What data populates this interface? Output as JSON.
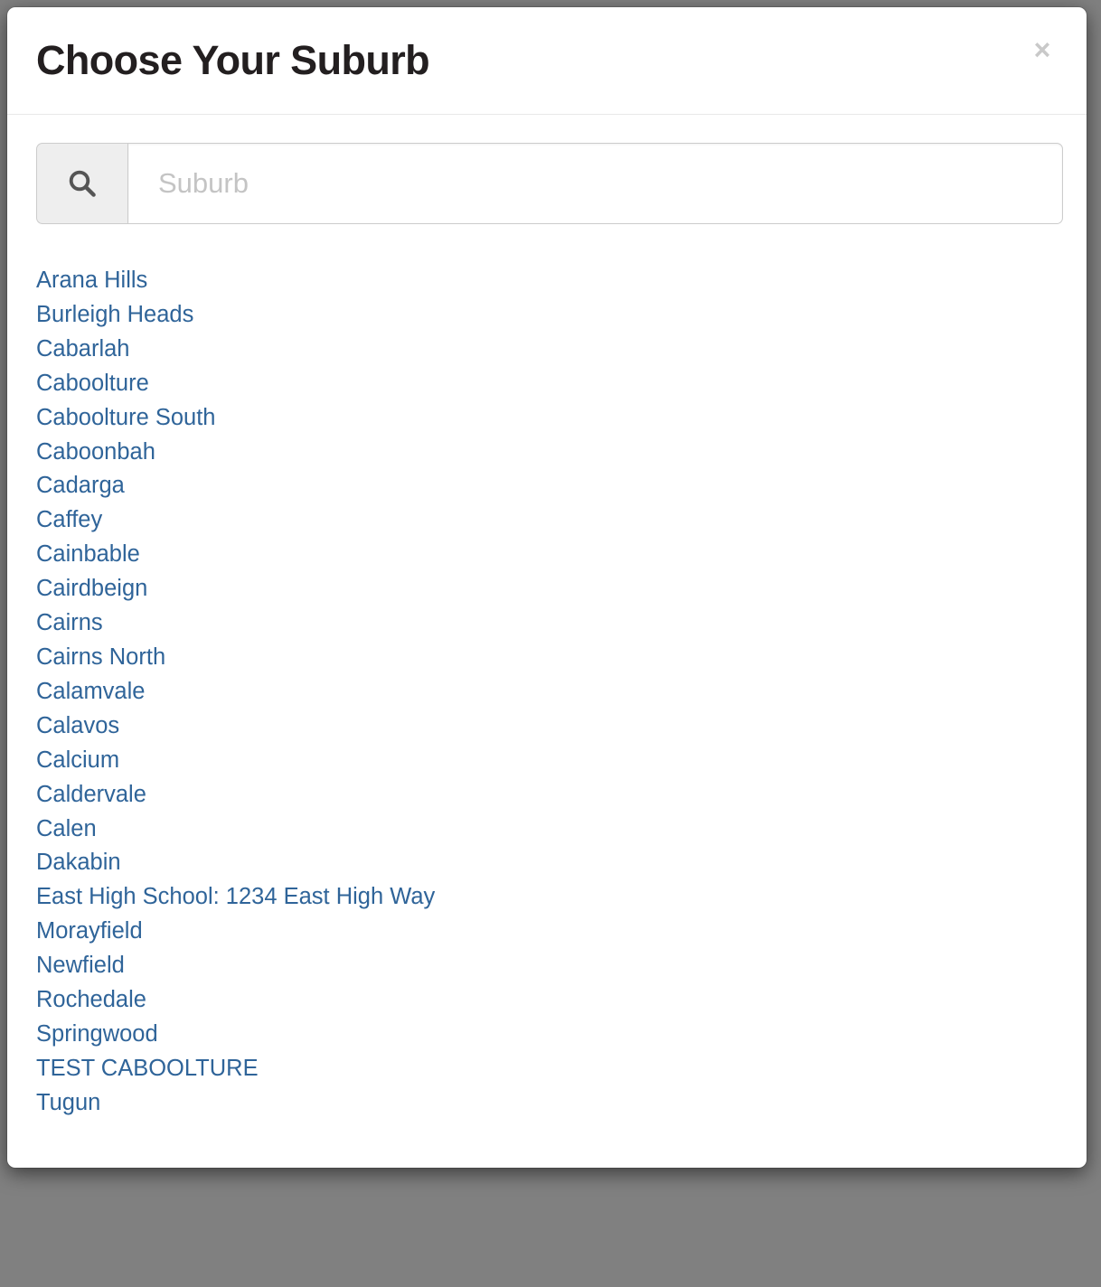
{
  "backdrop": {
    "color": "#808080"
  },
  "modal": {
    "title": "Choose Your Suburb",
    "close_label": "×",
    "accent_link_color": "#2f6499",
    "title_color": "#231f20"
  },
  "search": {
    "icon": "search-icon",
    "placeholder": "Suburb",
    "value": ""
  },
  "suburbs": [
    {
      "label": "Arana Hills"
    },
    {
      "label": "Burleigh Heads"
    },
    {
      "label": "Cabarlah"
    },
    {
      "label": "Caboolture"
    },
    {
      "label": "Caboolture South"
    },
    {
      "label": "Caboonbah"
    },
    {
      "label": "Cadarga"
    },
    {
      "label": "Caffey"
    },
    {
      "label": "Cainbable"
    },
    {
      "label": "Cairdbeign"
    },
    {
      "label": "Cairns"
    },
    {
      "label": "Cairns North"
    },
    {
      "label": "Calamvale"
    },
    {
      "label": "Calavos"
    },
    {
      "label": "Calcium"
    },
    {
      "label": "Caldervale"
    },
    {
      "label": "Calen"
    },
    {
      "label": "Dakabin"
    },
    {
      "label": "East High School: 1234 East High Way"
    },
    {
      "label": "Morayfield"
    },
    {
      "label": "Newfield"
    },
    {
      "label": "Rochedale"
    },
    {
      "label": "Springwood"
    },
    {
      "label": "TEST CABOOLTURE"
    },
    {
      "label": "Tugun"
    }
  ]
}
